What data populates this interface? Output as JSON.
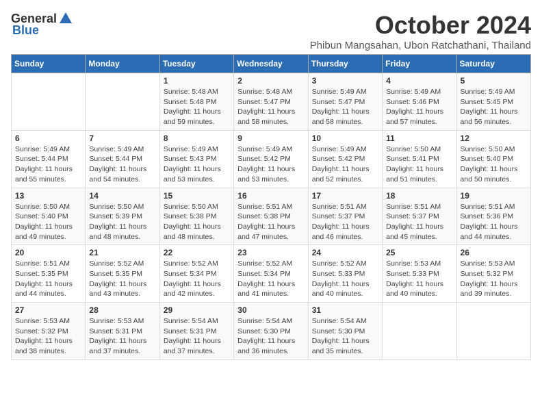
{
  "logo": {
    "general": "General",
    "blue": "Blue"
  },
  "title": {
    "month": "October 2024",
    "location": "Phibun Mangsahan, Ubon Ratchathani, Thailand"
  },
  "header_days": [
    "Sunday",
    "Monday",
    "Tuesday",
    "Wednesday",
    "Thursday",
    "Friday",
    "Saturday"
  ],
  "weeks": [
    [
      {
        "day": "",
        "sunrise": "",
        "sunset": "",
        "daylight": ""
      },
      {
        "day": "",
        "sunrise": "",
        "sunset": "",
        "daylight": ""
      },
      {
        "day": "1",
        "sunrise": "Sunrise: 5:48 AM",
        "sunset": "Sunset: 5:48 PM",
        "daylight": "Daylight: 11 hours and 59 minutes."
      },
      {
        "day": "2",
        "sunrise": "Sunrise: 5:48 AM",
        "sunset": "Sunset: 5:47 PM",
        "daylight": "Daylight: 11 hours and 58 minutes."
      },
      {
        "day": "3",
        "sunrise": "Sunrise: 5:49 AM",
        "sunset": "Sunset: 5:47 PM",
        "daylight": "Daylight: 11 hours and 58 minutes."
      },
      {
        "day": "4",
        "sunrise": "Sunrise: 5:49 AM",
        "sunset": "Sunset: 5:46 PM",
        "daylight": "Daylight: 11 hours and 57 minutes."
      },
      {
        "day": "5",
        "sunrise": "Sunrise: 5:49 AM",
        "sunset": "Sunset: 5:45 PM",
        "daylight": "Daylight: 11 hours and 56 minutes."
      }
    ],
    [
      {
        "day": "6",
        "sunrise": "Sunrise: 5:49 AM",
        "sunset": "Sunset: 5:44 PM",
        "daylight": "Daylight: 11 hours and 55 minutes."
      },
      {
        "day": "7",
        "sunrise": "Sunrise: 5:49 AM",
        "sunset": "Sunset: 5:44 PM",
        "daylight": "Daylight: 11 hours and 54 minutes."
      },
      {
        "day": "8",
        "sunrise": "Sunrise: 5:49 AM",
        "sunset": "Sunset: 5:43 PM",
        "daylight": "Daylight: 11 hours and 53 minutes."
      },
      {
        "day": "9",
        "sunrise": "Sunrise: 5:49 AM",
        "sunset": "Sunset: 5:42 PM",
        "daylight": "Daylight: 11 hours and 53 minutes."
      },
      {
        "day": "10",
        "sunrise": "Sunrise: 5:49 AM",
        "sunset": "Sunset: 5:42 PM",
        "daylight": "Daylight: 11 hours and 52 minutes."
      },
      {
        "day": "11",
        "sunrise": "Sunrise: 5:50 AM",
        "sunset": "Sunset: 5:41 PM",
        "daylight": "Daylight: 11 hours and 51 minutes."
      },
      {
        "day": "12",
        "sunrise": "Sunrise: 5:50 AM",
        "sunset": "Sunset: 5:40 PM",
        "daylight": "Daylight: 11 hours and 50 minutes."
      }
    ],
    [
      {
        "day": "13",
        "sunrise": "Sunrise: 5:50 AM",
        "sunset": "Sunset: 5:40 PM",
        "daylight": "Daylight: 11 hours and 49 minutes."
      },
      {
        "day": "14",
        "sunrise": "Sunrise: 5:50 AM",
        "sunset": "Sunset: 5:39 PM",
        "daylight": "Daylight: 11 hours and 48 minutes."
      },
      {
        "day": "15",
        "sunrise": "Sunrise: 5:50 AM",
        "sunset": "Sunset: 5:38 PM",
        "daylight": "Daylight: 11 hours and 48 minutes."
      },
      {
        "day": "16",
        "sunrise": "Sunrise: 5:51 AM",
        "sunset": "Sunset: 5:38 PM",
        "daylight": "Daylight: 11 hours and 47 minutes."
      },
      {
        "day": "17",
        "sunrise": "Sunrise: 5:51 AM",
        "sunset": "Sunset: 5:37 PM",
        "daylight": "Daylight: 11 hours and 46 minutes."
      },
      {
        "day": "18",
        "sunrise": "Sunrise: 5:51 AM",
        "sunset": "Sunset: 5:37 PM",
        "daylight": "Daylight: 11 hours and 45 minutes."
      },
      {
        "day": "19",
        "sunrise": "Sunrise: 5:51 AM",
        "sunset": "Sunset: 5:36 PM",
        "daylight": "Daylight: 11 hours and 44 minutes."
      }
    ],
    [
      {
        "day": "20",
        "sunrise": "Sunrise: 5:51 AM",
        "sunset": "Sunset: 5:35 PM",
        "daylight": "Daylight: 11 hours and 44 minutes."
      },
      {
        "day": "21",
        "sunrise": "Sunrise: 5:52 AM",
        "sunset": "Sunset: 5:35 PM",
        "daylight": "Daylight: 11 hours and 43 minutes."
      },
      {
        "day": "22",
        "sunrise": "Sunrise: 5:52 AM",
        "sunset": "Sunset: 5:34 PM",
        "daylight": "Daylight: 11 hours and 42 minutes."
      },
      {
        "day": "23",
        "sunrise": "Sunrise: 5:52 AM",
        "sunset": "Sunset: 5:34 PM",
        "daylight": "Daylight: 11 hours and 41 minutes."
      },
      {
        "day": "24",
        "sunrise": "Sunrise: 5:52 AM",
        "sunset": "Sunset: 5:33 PM",
        "daylight": "Daylight: 11 hours and 40 minutes."
      },
      {
        "day": "25",
        "sunrise": "Sunrise: 5:53 AM",
        "sunset": "Sunset: 5:33 PM",
        "daylight": "Daylight: 11 hours and 40 minutes."
      },
      {
        "day": "26",
        "sunrise": "Sunrise: 5:53 AM",
        "sunset": "Sunset: 5:32 PM",
        "daylight": "Daylight: 11 hours and 39 minutes."
      }
    ],
    [
      {
        "day": "27",
        "sunrise": "Sunrise: 5:53 AM",
        "sunset": "Sunset: 5:32 PM",
        "daylight": "Daylight: 11 hours and 38 minutes."
      },
      {
        "day": "28",
        "sunrise": "Sunrise: 5:53 AM",
        "sunset": "Sunset: 5:31 PM",
        "daylight": "Daylight: 11 hours and 37 minutes."
      },
      {
        "day": "29",
        "sunrise": "Sunrise: 5:54 AM",
        "sunset": "Sunset: 5:31 PM",
        "daylight": "Daylight: 11 hours and 37 minutes."
      },
      {
        "day": "30",
        "sunrise": "Sunrise: 5:54 AM",
        "sunset": "Sunset: 5:30 PM",
        "daylight": "Daylight: 11 hours and 36 minutes."
      },
      {
        "day": "31",
        "sunrise": "Sunrise: 5:54 AM",
        "sunset": "Sunset: 5:30 PM",
        "daylight": "Daylight: 11 hours and 35 minutes."
      },
      {
        "day": "",
        "sunrise": "",
        "sunset": "",
        "daylight": ""
      },
      {
        "day": "",
        "sunrise": "",
        "sunset": "",
        "daylight": ""
      }
    ]
  ]
}
